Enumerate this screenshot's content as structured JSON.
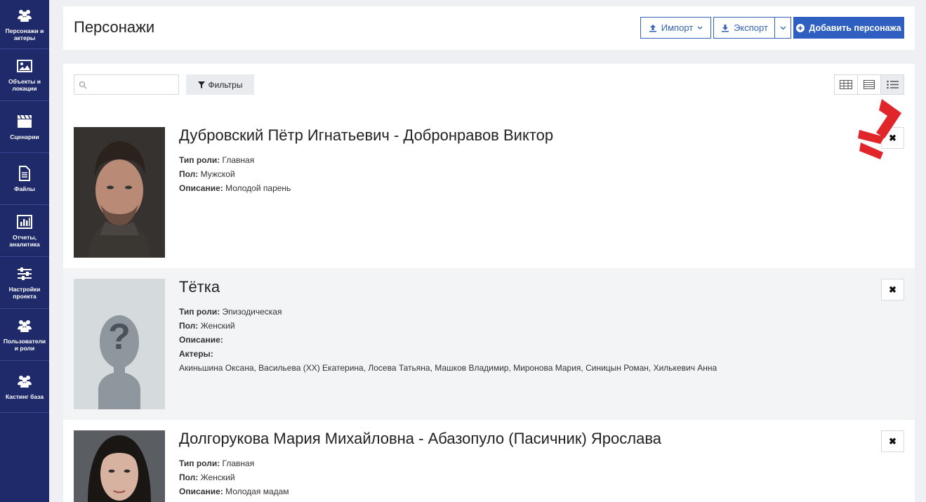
{
  "sidebar": {
    "items": [
      {
        "label": "Персонажи и актеры",
        "icon": "users-icon"
      },
      {
        "label": "Объекты и локации",
        "icon": "image-icon"
      },
      {
        "label": "Сценарии",
        "icon": "clapperboard-icon"
      },
      {
        "label": "Файлы",
        "icon": "file-icon"
      },
      {
        "label": "Отчеты, аналитика",
        "icon": "chart-icon"
      },
      {
        "label": "Настройки проекта",
        "icon": "sliders-icon"
      },
      {
        "label": "Пользователи и роли",
        "icon": "users-icon"
      },
      {
        "label": "Кастинг база",
        "icon": "users-icon"
      }
    ]
  },
  "header": {
    "title": "Персонажи",
    "import_label": "Импорт",
    "export_label": "Экспорт",
    "add_label": "Добавить персонажа"
  },
  "toolbar": {
    "search_placeholder": "",
    "filter_label": "Фильтры"
  },
  "labels": {
    "role_type": "Тип роли:",
    "gender": "Пол:",
    "description": "Описание:",
    "actors": "Актеры:"
  },
  "characters": [
    {
      "name": "Дубровский Пётр Игнатьевич - Добронравов Виктор",
      "role_type": "Главная",
      "gender": "Мужской",
      "description": "Молодой парень"
    },
    {
      "name": "Тётка",
      "role_type": "Эпизодическая",
      "gender": "Женский",
      "description": "",
      "actors": "Акиньшина Оксана, Васильева (ХХ) Екатерина, Лосева Татьяна, Машков Владимир, Миронова Мария, Синицын Роман, Хилькевич Анна"
    },
    {
      "name": "Долгорукова Мария Михайловна - Абазопуло (Пасичник) Ярослава",
      "role_type": "Главная",
      "gender": "Женский",
      "description": "Молодая мадам"
    }
  ],
  "colors": {
    "sidebar": "#1f2a6b",
    "primary": "#2f5fc0",
    "arrow": "#e0262b"
  }
}
